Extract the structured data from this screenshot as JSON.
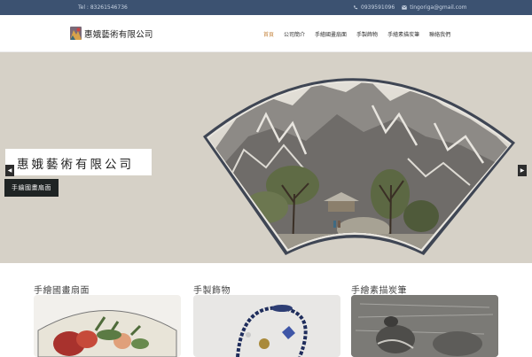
{
  "topbar": {
    "tel": "Tel : 83261546736",
    "mobile": "0939591096",
    "email": "tingoriga@gmail.com"
  },
  "header": {
    "company": "惠娥藝術有限公司",
    "nav": [
      {
        "label": "首頁",
        "active": true
      },
      {
        "label": "公司簡介",
        "active": false
      },
      {
        "label": "手繪國畫扇面",
        "active": false
      },
      {
        "label": "手製飾物",
        "active": false
      },
      {
        "label": "手繪素描炭筆",
        "active": false
      },
      {
        "label": "聯絡我們",
        "active": false
      }
    ]
  },
  "hero": {
    "title": "惠娥藝術有限公司",
    "button": "手繪國畫扇面",
    "prev": "◀",
    "next": "▶"
  },
  "products": [
    {
      "title": "手繪國畫扇面"
    },
    {
      "title": "手製飾物"
    },
    {
      "title": "手繪素描炭筆"
    }
  ],
  "colors": {
    "topbar": "#3c5271",
    "accent": "#c88a48",
    "hero_bg": "#d6d1c7",
    "button": "#1f2424"
  }
}
